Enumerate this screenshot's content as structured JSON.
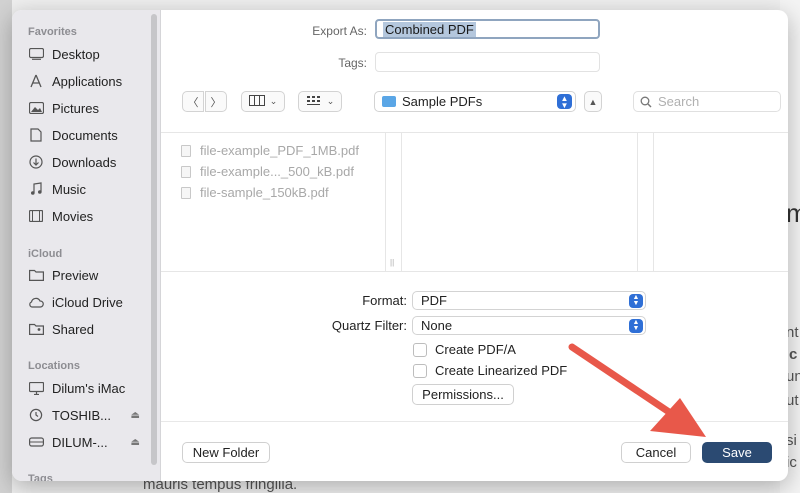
{
  "background": {
    "fragments": [
      {
        "text": "m",
        "big": true
      },
      {
        "text": "nt"
      },
      {
        "text": "c"
      },
      {
        "text": "un"
      },
      {
        "text": "ut"
      },
      {
        "text": "si"
      },
      {
        "text": "ic"
      },
      {
        "text": "mauris tempus fringilla."
      }
    ]
  },
  "sidebar": {
    "favorites_header": "Favorites",
    "favorites": [
      {
        "label": "Desktop",
        "icon": "desktop-icon"
      },
      {
        "label": "Applications",
        "icon": "applications-icon"
      },
      {
        "label": "Pictures",
        "icon": "pictures-icon"
      },
      {
        "label": "Documents",
        "icon": "document-icon"
      },
      {
        "label": "Downloads",
        "icon": "downloads-icon"
      },
      {
        "label": "Music",
        "icon": "music-icon"
      },
      {
        "label": "Movies",
        "icon": "movies-icon"
      }
    ],
    "icloud_header": "iCloud",
    "icloud": [
      {
        "label": "Preview",
        "icon": "folder-icon"
      },
      {
        "label": "iCloud Drive",
        "icon": "cloud-icon"
      },
      {
        "label": "Shared",
        "icon": "shared-folder-icon"
      }
    ],
    "locations_header": "Locations",
    "locations": [
      {
        "label": "Dilum's iMac",
        "icon": "computer-icon"
      },
      {
        "label": "TOSHIB...",
        "icon": "time-machine-icon"
      },
      {
        "label": "DILUM-...",
        "icon": "drive-icon"
      }
    ],
    "tags_header": "Tags"
  },
  "form": {
    "export_as_label": "Export As:",
    "export_as_value": "Combined PDF",
    "tags_label": "Tags:"
  },
  "toolbar": {
    "location": "Sample PDFs",
    "search_placeholder": "Search"
  },
  "files": [
    "file-example_PDF_1MB.pdf",
    "file-example..._500_kB.pdf",
    "file-sample_150kB.pdf"
  ],
  "options": {
    "format_label": "Format:",
    "format_value": "PDF",
    "quartz_label": "Quartz Filter:",
    "quartz_value": "None",
    "create_pdfa": "Create PDF/A",
    "create_linearized": "Create Linearized PDF",
    "permissions": "Permissions..."
  },
  "buttons": {
    "new_folder": "New Folder",
    "cancel": "Cancel",
    "save": "Save"
  },
  "colors": {
    "accent": "#2f6fd6",
    "save_button": "#2b4a72",
    "annotation_arrow": "#e8584a"
  }
}
